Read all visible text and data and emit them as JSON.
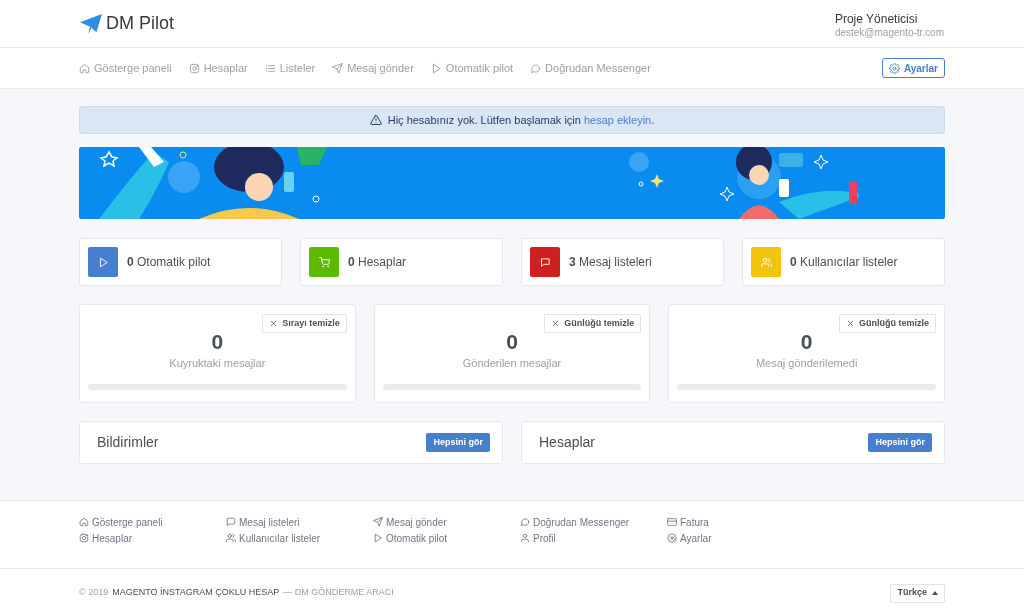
{
  "header": {
    "logo": "DM Pilot",
    "user_name": "Proje Yöneticisi",
    "user_email": "destek@magento-tr.com"
  },
  "nav": {
    "items": [
      {
        "kind": "home",
        "label": "Gösterge paneli"
      },
      {
        "kind": "camera",
        "label": "Hesaplar"
      },
      {
        "kind": "list",
        "label": "Listeler"
      },
      {
        "kind": "send",
        "label": "Mesaj gönder"
      },
      {
        "kind": "play",
        "label": "Otomatik pilot"
      },
      {
        "kind": "chat",
        "label": "Doğrudan Messenger"
      }
    ],
    "settings_button": "Ayarlar"
  },
  "alert": {
    "before": "Hiç hesabınız yok. Lütfen başlamak için ",
    "link": "hesap ekleyin",
    "after": "."
  },
  "stats": [
    {
      "kind": "play",
      "color": "#467fcf",
      "text": "**0** Otomatik pilot"
    },
    {
      "kind": "cart",
      "color": "#5eba00",
      "text": "**0** Hesaplar"
    },
    {
      "kind": "flag",
      "color": "#cd201f",
      "text": "**3** Mesaj listeleri"
    },
    {
      "kind": "users",
      "color": "#f1c40f",
      "text": "**0** Kullanıcılar listeler"
    }
  ],
  "counters": [
    {
      "button": "Sırayı temizle",
      "value": "0",
      "label": "Kuyruktaki mesajlar"
    },
    {
      "button": "Günlüğü temizle",
      "value": "0",
      "label": "Gönderilen mesajlar"
    },
    {
      "button": "Günlüğü temizle",
      "value": "0",
      "label": "Mesaj gönderilemedi"
    }
  ],
  "panels": [
    {
      "title": "Bildirimler",
      "button": "Hepsini gör"
    },
    {
      "title": "Hesaplar",
      "button": "Hepsini gör"
    }
  ],
  "footer": {
    "links": [
      {
        "kind": "home",
        "label": "Gösterge paneli"
      },
      {
        "kind": "camera",
        "label": "Hesaplar"
      },
      {
        "kind": "chat-square",
        "label": "Mesaj listeleri"
      },
      {
        "kind": "users",
        "label": "Kullanıcılar listeler"
      },
      {
        "kind": "send",
        "label": "Mesaj gönder"
      },
      {
        "kind": "play",
        "label": "Otomatik pilot"
      },
      {
        "kind": "chat",
        "label": "Doğrudan Messenger"
      },
      {
        "kind": "user",
        "label": "Profil"
      },
      {
        "kind": "card",
        "label": "Fatura"
      },
      {
        "kind": "gear",
        "label": "Ayarlar"
      }
    ],
    "copyright_year": "© 2019",
    "copyright_brand": "MAGENTO İNSTAGRAM ÇOKLU HESAP",
    "copyright_tail": "— DM GÖNDERME ARACI",
    "language": "Türkçe"
  }
}
